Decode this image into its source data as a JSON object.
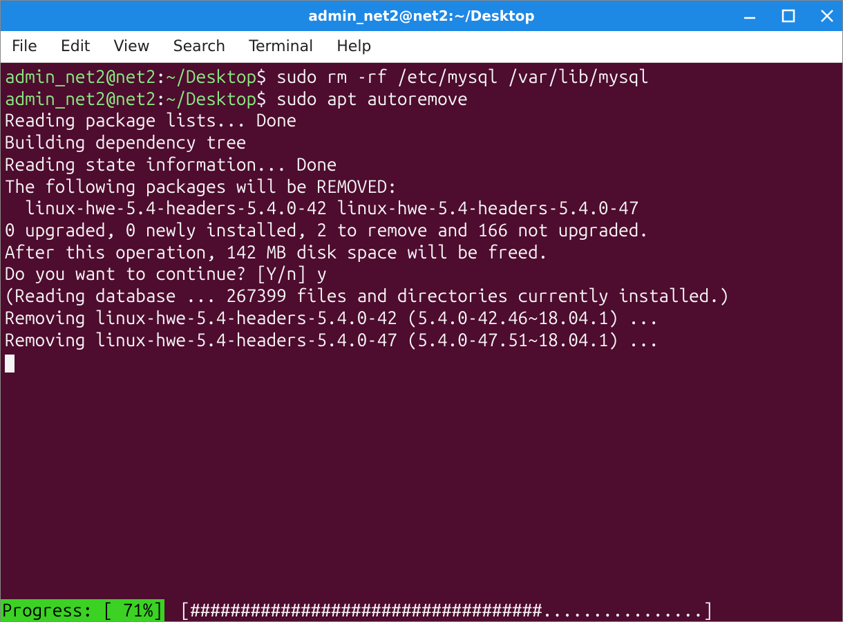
{
  "colors": {
    "titlebar": "#1e88e5",
    "terminal_bg": "#4e0c2e",
    "terminal_fg": "#f5f5f5",
    "prompt_user": "#8aea83",
    "progress_bg": "#3bd224"
  },
  "window": {
    "title": "admin_net2@net2:~/Desktop"
  },
  "menu": {
    "items": [
      "File",
      "Edit",
      "View",
      "Search",
      "Terminal",
      "Help"
    ]
  },
  "terminal": {
    "prompt1_user": "admin_net2@net2",
    "prompt1_path": "~/Desktop",
    "prompt1_sep": ":",
    "prompt1_end": "$ ",
    "cmd1": "sudo rm -rf /etc/mysql /var/lib/mysql",
    "prompt2_user": "admin_net2@net2",
    "prompt2_path": "~/Desktop",
    "prompt2_sep": ":",
    "prompt2_end": "$ ",
    "cmd2": "sudo apt autoremove",
    "out1": "Reading package lists... Done",
    "out2": "Building dependency tree",
    "out3": "Reading state information... Done",
    "out4": "The following packages will be REMOVED:",
    "out5": "  linux-hwe-5.4-headers-5.4.0-42 linux-hwe-5.4-headers-5.4.0-47",
    "out6": "0 upgraded, 0 newly installed, 2 to remove and 166 not upgraded.",
    "out7": "After this operation, 142 MB disk space will be freed.",
    "out8": "Do you want to continue? [Y/n] y",
    "out9": "(Reading database ... 267399 files and directories currently installed.)",
    "out10": "Removing linux-hwe-5.4-headers-5.4.0-42 (5.4.0-42.46~18.04.1) ...",
    "out11": "Removing linux-hwe-5.4-headers-5.4.0-47 (5.4.0-47.51~18.04.1) ..."
  },
  "progress": {
    "percent": 71,
    "label": "Progress: [ 71%]",
    "bar": " [###################################................]"
  }
}
